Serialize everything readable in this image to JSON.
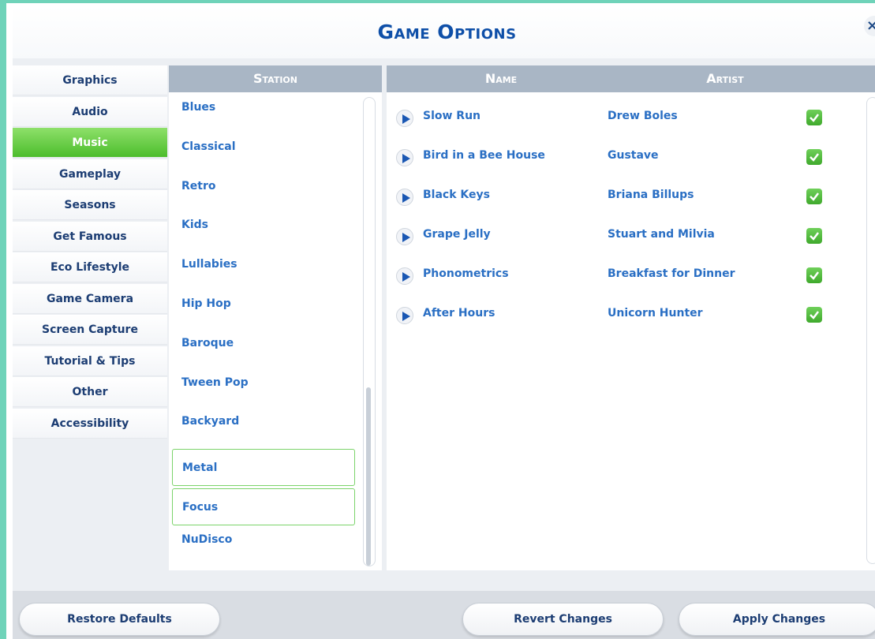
{
  "window": {
    "title": "Game Options",
    "close_label": "×"
  },
  "nav": {
    "items": [
      {
        "label": "Graphics",
        "active": false
      },
      {
        "label": "Audio",
        "active": false
      },
      {
        "label": "Music",
        "active": true
      },
      {
        "label": "Gameplay",
        "active": false
      },
      {
        "label": "Seasons",
        "active": false
      },
      {
        "label": "Get Famous",
        "active": false
      },
      {
        "label": "Eco Lifestyle",
        "active": false
      },
      {
        "label": "Game Camera",
        "active": false
      },
      {
        "label": "Screen Capture",
        "active": false
      },
      {
        "label": "Tutorial & Tips",
        "active": false
      },
      {
        "label": "Other",
        "active": false
      },
      {
        "label": "Accessibility",
        "active": false
      }
    ]
  },
  "stations": {
    "header": "Station",
    "items": [
      {
        "label": "Blues",
        "checked": false
      },
      {
        "label": "Classical",
        "checked": false
      },
      {
        "label": "Retro",
        "checked": false
      },
      {
        "label": "Kids",
        "checked": false
      },
      {
        "label": "Lullabies",
        "checked": false
      },
      {
        "label": "Hip Hop",
        "checked": false
      },
      {
        "label": "Baroque",
        "checked": false
      },
      {
        "label": "Tween Pop",
        "checked": false
      },
      {
        "label": "Backyard",
        "checked": false
      },
      {
        "label": "Metal",
        "checked": true
      },
      {
        "label": "Focus",
        "checked": true
      },
      {
        "label": "NuDisco",
        "checked": false
      }
    ]
  },
  "songs": {
    "name_header": "Name",
    "artist_header": "Artist",
    "rows": [
      {
        "name": "Slow Run",
        "artist": "Drew Boles",
        "enabled": true
      },
      {
        "name": "Bird in a Bee House",
        "artist": "Gustave",
        "enabled": true
      },
      {
        "name": "Black Keys",
        "artist": "Briana Billups",
        "enabled": true
      },
      {
        "name": "Grape Jelly",
        "artist": "Stuart and Milvia",
        "enabled": true
      },
      {
        "name": "Phonometrics",
        "artist": "Breakfast for Dinner",
        "enabled": true
      },
      {
        "name": "After Hours",
        "artist": "Unicorn Hunter",
        "enabled": true
      }
    ]
  },
  "footer": {
    "restore_label": "Restore Defaults",
    "revert_label": "Revert Changes",
    "apply_label": "Apply Changes"
  },
  "colors": {
    "frame": "#6fd3b9",
    "title": "#0e4fa8",
    "link": "#2a6fc4",
    "active_tab": "#4cbd2c",
    "panel_header": "#a9b6c5"
  }
}
